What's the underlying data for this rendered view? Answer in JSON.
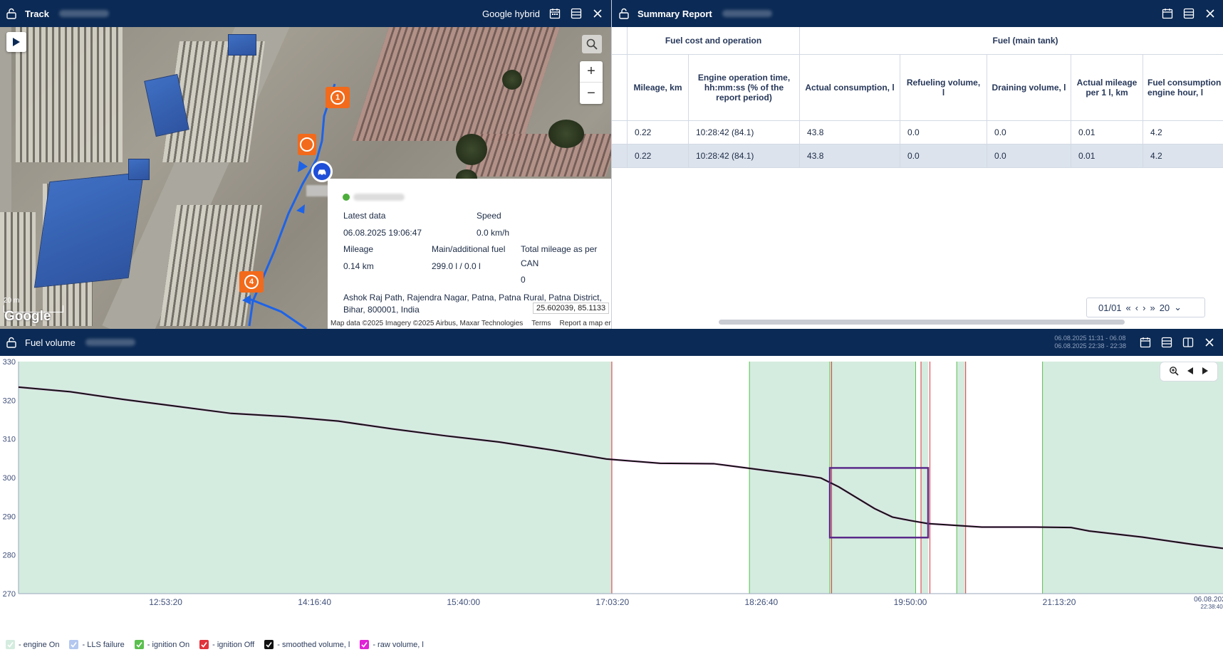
{
  "map_panel": {
    "title": "Track",
    "map_type": "Google hybrid",
    "markers": [
      {
        "label": "1"
      },
      {
        "label": "4"
      }
    ],
    "scale_label": "20 m",
    "google_logo": "Google",
    "zoom_in": "+",
    "zoom_out": "−",
    "info": {
      "latest_data_label": "Latest data",
      "latest_data_value": "06.08.2025 19:06:47",
      "speed_label": "Speed",
      "speed_value": "0.0 km/h",
      "mileage_label": "Mileage",
      "mileage_value": "0.14 km",
      "fuel_label": "Main/additional fuel",
      "fuel_value": "299.0 l / 0.0 l",
      "can_label_1": "Total mileage as per",
      "can_label_2": "CAN",
      "can_value": "0",
      "address_1": "Ashok Raj Path, Rajendra Nagar, Patna, Patna Rural, Patna District,",
      "address_2": "Bihar, 800001, India",
      "coordinates": "25.602039,  85.1133"
    },
    "attribution": {
      "data": "Map data ©2025 Imagery ©2025 Airbus, Maxar Technologies",
      "terms": "Terms",
      "report": "Report a map error"
    }
  },
  "report_panel": {
    "title": "Summary Report",
    "group_headers": [
      "Fuel cost and operation",
      "Fuel (main tank)"
    ],
    "columns": [
      "Mileage, km",
      "Engine operation time, hh:mm:ss (% of the report period)",
      "Actual consumption, l",
      "Refueling volume, l",
      "Draining volume, l",
      "Actual mileage per 1 l, km",
      "Fuel consumption engine hour, l"
    ],
    "rows": [
      [
        "0.22",
        "10:28:42 (84.1)",
        "43.8",
        "0.0",
        "0.0",
        "0.01",
        "4.2"
      ],
      [
        "0.22",
        "10:28:42 (84.1)",
        "43.8",
        "0.0",
        "0.0",
        "0.01",
        "4.2"
      ]
    ],
    "pager": {
      "page": "01/01",
      "per_page": "20"
    }
  },
  "fuel_panel": {
    "title": "Fuel volume",
    "date_range_1": "06.08.2025 11:31 - 06.08",
    "date_range_2": "06.08.2025 22:38 - 22:38",
    "legend": [
      {
        "label": "- engine On",
        "color": "#d4ecdf"
      },
      {
        "label": "- LLS failure",
        "color": "#b3c7ef"
      },
      {
        "label": "- ignition On",
        "color": "#5bbf4e"
      },
      {
        "label": "- ignition Off",
        "color": "#e0333b"
      },
      {
        "label": "- smoothed volume, l",
        "color": "#111111"
      },
      {
        "label": "- raw volume, l",
        "color": "#e021d6"
      }
    ]
  },
  "chart_data": {
    "type": "line",
    "title": "",
    "ylim": [
      270,
      330
    ],
    "y_ticks": [
      330,
      320,
      310,
      300,
      290,
      280,
      270
    ],
    "x_ticks": [
      "12:53:20",
      "14:16:40",
      "15:40:00",
      "17:03:20",
      "18:26:40",
      "19:50:00",
      "21:13:20"
    ],
    "x_last_tick_date": "06.08.2025",
    "x_last_tick_time": "22:38:40",
    "x_range": [
      "11:31",
      "22:45"
    ],
    "series": [
      {
        "name": "- smoothed volume, l",
        "x": [
          "11:31",
          "12:00",
          "12:30",
          "13:00",
          "13:30",
          "14:00",
          "14:30",
          "15:00",
          "15:30",
          "16:00",
          "16:30",
          "17:00",
          "17:30",
          "18:00",
          "18:30",
          "18:50",
          "19:00",
          "19:10",
          "19:20",
          "19:30",
          "19:40",
          "19:50",
          "20:00",
          "20:30",
          "21:00",
          "21:20",
          "21:30",
          "22:00",
          "22:30",
          "22:45"
        ],
        "values": [
          323.4,
          322.2,
          320.2,
          318.4,
          316.6,
          315.8,
          314.6,
          312.6,
          310.8,
          309.2,
          307.1,
          304.8,
          303.7,
          303.6,
          301.8,
          300.6,
          299.9,
          297.6,
          294.8,
          292.0,
          289.8,
          288.9,
          288.1,
          287.2,
          287.2,
          287.1,
          286.2,
          284.6,
          282.6,
          281.7
        ]
      }
    ],
    "bands": [
      {
        "type": "engine On",
        "from": "11:31",
        "to": "17:03"
      },
      {
        "type": "engine On",
        "from": "18:20",
        "to": "19:53"
      },
      {
        "type": "engine On",
        "from": "19:56",
        "to": "20:00"
      },
      {
        "type": "engine On",
        "from": "20:16",
        "to": "20:21"
      },
      {
        "type": "engine On",
        "from": "21:04",
        "to": "22:45"
      }
    ],
    "ignition_on": [
      "18:20",
      "19:05",
      "19:53",
      "20:16",
      "21:04"
    ],
    "ignition_off": [
      "17:03",
      "19:06",
      "19:56",
      "20:01",
      "20:21"
    ],
    "highlight": {
      "from": "19:05",
      "to": "20:00",
      "y_top": 302.5,
      "y_bottom": 284.5
    },
    "grid": false
  }
}
